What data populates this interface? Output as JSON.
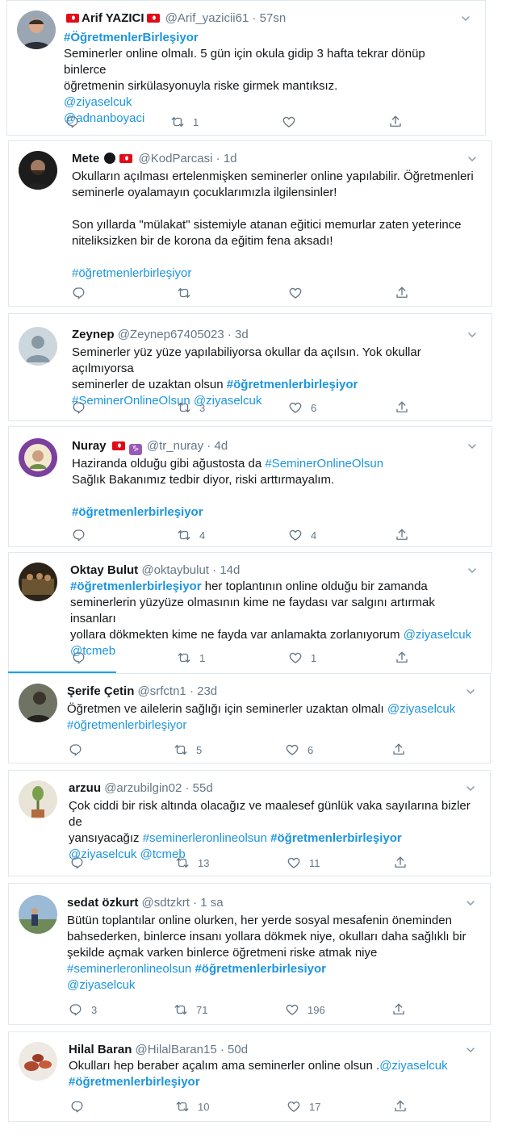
{
  "tweets": [
    {
      "name": "Arif YAZICI",
      "handle": "@Arif_yazicii61",
      "time": "57sn",
      "lines": [
        [
          {
            "t": "#ÖğretmenlerBirleşiyor",
            "s": "hb"
          }
        ],
        [
          {
            "t": "Seminerler online olmalı. 5 gün için okula gidip 3 hafta tekrar dönüp binlerce"
          }
        ],
        [
          {
            "t": "öğretmenin sirkülasyonuyla riske girmek mantıksız."
          }
        ],
        [
          {
            "t": "@ziyaselcuk",
            "s": "l"
          }
        ],
        [
          {
            "t": "@adnanboyaci",
            "s": "l"
          }
        ]
      ],
      "replies": "",
      "retweets": "1",
      "likes": ""
    },
    {
      "name": "Mete",
      "handle": "@KodParcasi",
      "time": "1d",
      "lines": [
        [
          {
            "t": "Okulların açılması ertelenmişken seminerler online yapılabilir. Öğretmenleri"
          }
        ],
        [
          {
            "t": "seminerle oyalamayın çocuklarımızla ilgilensinler!"
          }
        ],
        [],
        [
          {
            "t": "Son yıllarda \"mülakat\" sistemiyle atanan eğitici memurlar zaten yeterince"
          }
        ],
        [
          {
            "t": "niteliksizken bir de korona da eğitim fena aksadı!"
          }
        ],
        [],
        [
          {
            "t": "#öğretmenlerbirleşiyor",
            "s": "l"
          }
        ]
      ],
      "replies": "",
      "retweets": "",
      "likes": ""
    },
    {
      "name": "Zeynep",
      "handle": "@Zeynep67405023",
      "time": "3d",
      "lines": [
        [
          {
            "t": "Seminerler yüz yüze yapılabiliyorsa okullar da açılsın. Yok okullar açılmıyorsa"
          }
        ],
        [
          {
            "t": "seminerler de uzaktan olsun "
          },
          {
            "t": "#öğretmenlerbirleşiyor",
            "s": "hb"
          }
        ],
        [
          {
            "t": "#SeminerOnlineOlsun",
            "s": "l"
          },
          {
            "t": " "
          },
          {
            "t": "@ziyaselcuk",
            "s": "l"
          }
        ]
      ],
      "replies": "",
      "retweets": "3",
      "likes": "6"
    },
    {
      "name": "Nuray",
      "handle": "@tr_nuray",
      "time": "4d",
      "lines": [
        [
          {
            "t": "Haziranda olduğu gibi ağustosta da "
          },
          {
            "t": "#SeminerOnlineOlsun",
            "s": "l"
          }
        ],
        [
          {
            "t": "Sağlık Bakanımız tedbir diyor, riski arttırmayalım."
          }
        ],
        [],
        [
          {
            "t": "#öğretmenlerbirleşiyor",
            "s": "hb"
          }
        ]
      ],
      "replies": "",
      "retweets": "4",
      "likes": "4"
    },
    {
      "name": "Oktay Bulut",
      "handle": "@oktaybulut",
      "time": "14d",
      "lines": [
        [
          {
            "t": "#öğretmenlerbirleşiyor",
            "s": "hb"
          },
          {
            "t": " her toplantının online olduğu bir zamanda"
          }
        ],
        [
          {
            "t": "seminerlerin yüzyüze olmasının kime ne faydası var salgını artırmak insanları"
          }
        ],
        [
          {
            "t": "yollara dökmekten kime ne fayda var anlamakta zorlanıyorum "
          },
          {
            "t": "@ziyaselcuk",
            "s": "l"
          }
        ],
        [
          {
            "t": "@tcmeb",
            "s": "l"
          }
        ]
      ],
      "replies": "",
      "retweets": "1",
      "likes": "1"
    },
    {
      "name": "Şerife Çetin",
      "handle": "@srfctn1",
      "time": "23d",
      "lines": [
        [
          {
            "t": "Öğretmen ve ailelerin sağlığı için seminerler uzaktan olmalı "
          },
          {
            "t": "@ziyaselcuk",
            "s": "l"
          }
        ],
        [
          {
            "t": "#öğretmenlerbirleşiyor",
            "s": "l"
          }
        ]
      ],
      "replies": "",
      "retweets": "5",
      "likes": "6"
    },
    {
      "name": "arzuu",
      "handle": "@arzubilgin02",
      "time": "55d",
      "lines": [
        [
          {
            "t": "Çok ciddi bir risk altında olacağız ve maalesef günlük vaka sayılarına bizler de"
          }
        ],
        [
          {
            "t": "yansıyacağız "
          },
          {
            "t": "#seminerleronlineolsun",
            "s": "l"
          },
          {
            "t": " "
          },
          {
            "t": "#öğretmenlerbirleşiyor",
            "s": "hb"
          }
        ],
        [
          {
            "t": "@ziyaselcuk",
            "s": "l"
          },
          {
            "t": " "
          },
          {
            "t": "@tcmeb",
            "s": "l"
          }
        ]
      ],
      "replies": "",
      "retweets": "13",
      "likes": "11"
    },
    {
      "name": "sedat özkurt",
      "handle": "@sdtzkrt",
      "time": "1 sa",
      "lines": [
        [
          {
            "t": "Bütün toplantılar online olurken, her yerde sosyal mesafenin öneminden"
          }
        ],
        [
          {
            "t": "bahsederken, binlerce insanı yollara dökmek niye, okulları daha sağlıklı bir"
          }
        ],
        [
          {
            "t": "şekilde açmak varken binlerce öğretmeni riske atmak niye"
          }
        ],
        [
          {
            "t": "#seminerleronlineolsun",
            "s": "l"
          },
          {
            "t": " "
          },
          {
            "t": "#öğretmenlerbirlesiyor",
            "s": "hb"
          }
        ],
        [
          {
            "t": " @ziyaselcuk",
            "s": "l"
          }
        ]
      ],
      "replies": "3",
      "retweets": "71",
      "likes": "196"
    },
    {
      "name": "Hilal Baran",
      "handle": "@HilalBaran15",
      "time": "50d",
      "lines": [
        [
          {
            "t": "Okulları hep beraber açalım ama seminerler online olsun ."
          },
          {
            "t": "@ziyaselcuk",
            "s": "l"
          }
        ],
        [
          {
            "t": "#öğretmenlerbirleşiyor",
            "s": "hb"
          }
        ]
      ],
      "replies": "",
      "retweets": "10",
      "likes": "17"
    }
  ],
  "colors": {
    "link": "#1b95e0",
    "muted": "#657786",
    "border": "#e1e8ed",
    "accent": "#1da1f2"
  },
  "icons": {
    "reply": "reply-icon",
    "retweet": "retweet-icon",
    "like": "heart-icon",
    "share": "share-icon",
    "more": "chevron-down-icon"
  }
}
